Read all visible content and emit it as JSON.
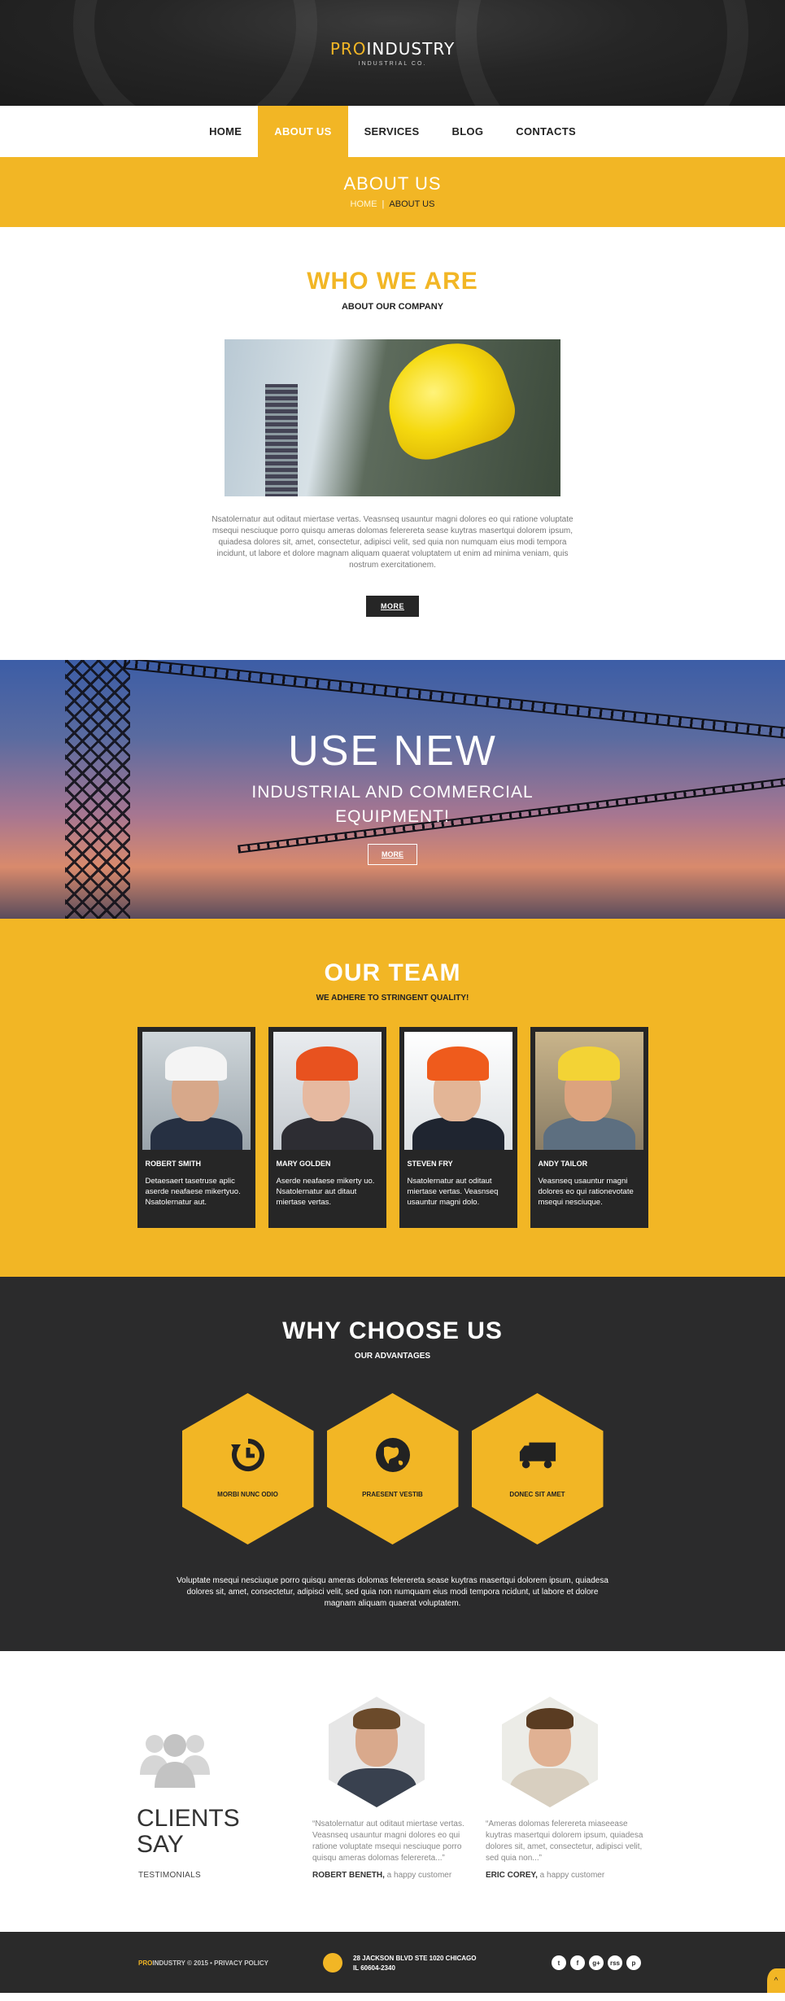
{
  "brand": {
    "name_highlight": "PRO",
    "name_rest": "INDUSTRY",
    "tagline": "INDUSTRIAL CO."
  },
  "nav": {
    "items": [
      "HOME",
      "ABOUT US",
      "SERVICES",
      "BLOG",
      "CONTACTS"
    ],
    "active": "ABOUT US"
  },
  "page_header": {
    "title": "ABOUT US",
    "breadcrumb_home": "HOME",
    "breadcrumb_sep": "|",
    "breadcrumb_current": "ABOUT US"
  },
  "who": {
    "title": "WHO WE ARE",
    "subtitle": "ABOUT OUR COMPANY",
    "text": "Nsatolernatur aut oditaut miertase vertas. Veasnseq usauntur magni dolores eo qui ratione voluptate msequi nesciuque porro quisqu ameras dolomas felerereta sease kuytras masertqui dolorem ipsum, quiadesa dolores sit, amet, consectetur, adipisci velit, sed quia non numquam eius modi tempora incidunt, ut labore et dolore magnam aliquam quaerat voluptatem ut enim ad minima veniam, quis nostrum exercitationem.",
    "button": "MORE"
  },
  "banner": {
    "headline": "USE NEW",
    "subline": "INDUSTRIAL AND COMMERCIAL EQUIPMENT!",
    "button": "MORE"
  },
  "team": {
    "title": "OUR TEAM",
    "subtitle": "WE ADHERE TO STRINGENT QUALITY!",
    "members": [
      {
        "name": "ROBERT SMITH",
        "desc": "Detaesaert tasetruse aplic aserde neafaese mikertyuo. Nsatolernatur aut."
      },
      {
        "name": "MARY GOLDEN",
        "desc": "Aserde neafaese mikerty uo. Nsatolernatur aut ditaut miertase vertas."
      },
      {
        "name": "STEVEN FRY",
        "desc": "Nsatolernatur aut oditaut miertase vertas. Veasnseq usauntur magni dolo."
      },
      {
        "name": "ANDY TAILOR",
        "desc": "Veasnseq usauntur magni dolores eo qui rationevotate msequi nesciuque."
      }
    ]
  },
  "why": {
    "title": "WHY CHOOSE US",
    "subtitle": "OUR ADVANTAGES",
    "features": [
      {
        "label": "MORBI NUNC ODIO",
        "icon": "history-icon"
      },
      {
        "label": "PRAESENT VESTIB",
        "icon": "globe-icon"
      },
      {
        "label": "DONEC SIT AMET",
        "icon": "truck-icon"
      }
    ],
    "text": "Voluptate msequi nesciuque porro quisqu ameras dolomas felerereta sease kuytras masertqui dolorem ipsum, quiadesa dolores sit, amet, consectetur, adipisci velit, sed quia non numquam eius modi tempora ncidunt, ut labore et dolore magnam aliquam quaerat voluptatem."
  },
  "clients": {
    "title_line1": "CLIENTS",
    "title_line2": "SAY",
    "subtitle": "TESTIMONIALS",
    "items": [
      {
        "quote": "“Nsatolernatur aut oditaut miertase vertas. Veasnseq usauntur magni dolores eo qui ratione voluptate msequi nesciuque porro quisqu ameras dolomas felerereta...”",
        "author": "ROBERT BENETH,",
        "role": " a happy customer"
      },
      {
        "quote": "“Ameras dolomas felerereta miaseease kuytras masertqui dolorem ipsum, quiadesa dolores sit, amet, consectetur, adipisci velit, sed quia non...”",
        "author": "ERIC COREY,",
        "role": " a happy customer"
      }
    ]
  },
  "footer": {
    "brand_highlight": "PRO",
    "copyright": "INDUSTRY © 2015  •  PRIVACY POLICY",
    "address_line1": "28 JACKSON BLVD STE 1020 CHICAGO",
    "address_line2": "IL 60604-2340",
    "socials": [
      "t",
      "f",
      "g+",
      "rss",
      "p"
    ],
    "to_top": "^"
  },
  "colors": {
    "accent": "#f2b625",
    "dark": "#2b2b2c",
    "card": "#262626"
  }
}
